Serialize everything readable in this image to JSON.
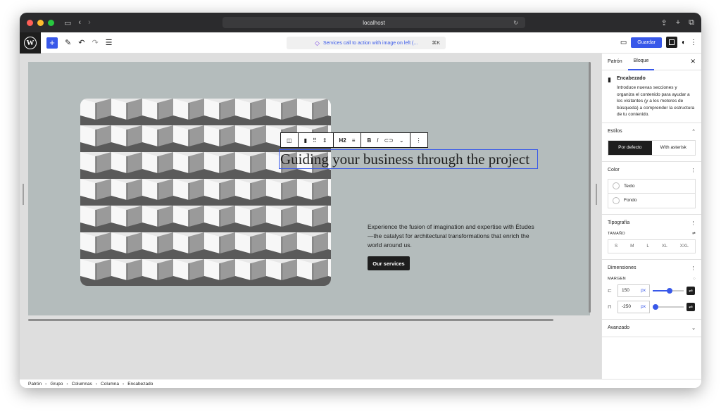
{
  "browser": {
    "address": "localhost",
    "traffic_colors": [
      "#ff5f57",
      "#febc2e",
      "#28c840"
    ]
  },
  "toolbar": {
    "add_icon": "plus-icon",
    "document_title": "Services call to action with image on left (...",
    "shortcut": "⌘K",
    "save_label": "Guardar"
  },
  "canvas": {
    "background": "#b4bcbc",
    "heading": "Guiding your business through the project",
    "block_toolbar": {
      "heading_level": "H2",
      "bold": "B",
      "italic": "I"
    },
    "paragraph": "Experience the fusion of imagination and expertise with Études—the catalyst for architectural transformations that enrich the world around us.",
    "cta_label": "Our services"
  },
  "sidebar": {
    "tabs": [
      "Patrón",
      "Bloque"
    ],
    "active_tab": "Bloque",
    "block": {
      "title": "Encabezado",
      "description": "Introduce nuevas secciones y organiza el contenido para ayudar a los visitantes (y a los motores de búsqueda) a comprender la estructura de tu contenido."
    },
    "styles": {
      "title": "Estilos",
      "options": [
        "Por defecto",
        "With asterisk"
      ],
      "selected": "Por defecto"
    },
    "color": {
      "title": "Color",
      "items": [
        "Texto",
        "Fondo"
      ]
    },
    "typography": {
      "title": "Tipografía",
      "size_label": "TAMAÑO",
      "sizes": [
        "S",
        "M",
        "L",
        "XL",
        "XXL"
      ]
    },
    "dimensions": {
      "title": "Dimensiones",
      "margin_label": "MARGEN",
      "vertical": {
        "value": "150",
        "unit": "px",
        "slider": 0.55
      },
      "horizontal": {
        "value": "-250",
        "unit": "px",
        "slider": 0.0
      }
    },
    "advanced": {
      "title": "Avanzado"
    }
  },
  "breadcrumb": [
    "Patrón",
    "Grupo",
    "Columnas",
    "Columna",
    "Encabezado"
  ],
  "accent": "#3858e9"
}
